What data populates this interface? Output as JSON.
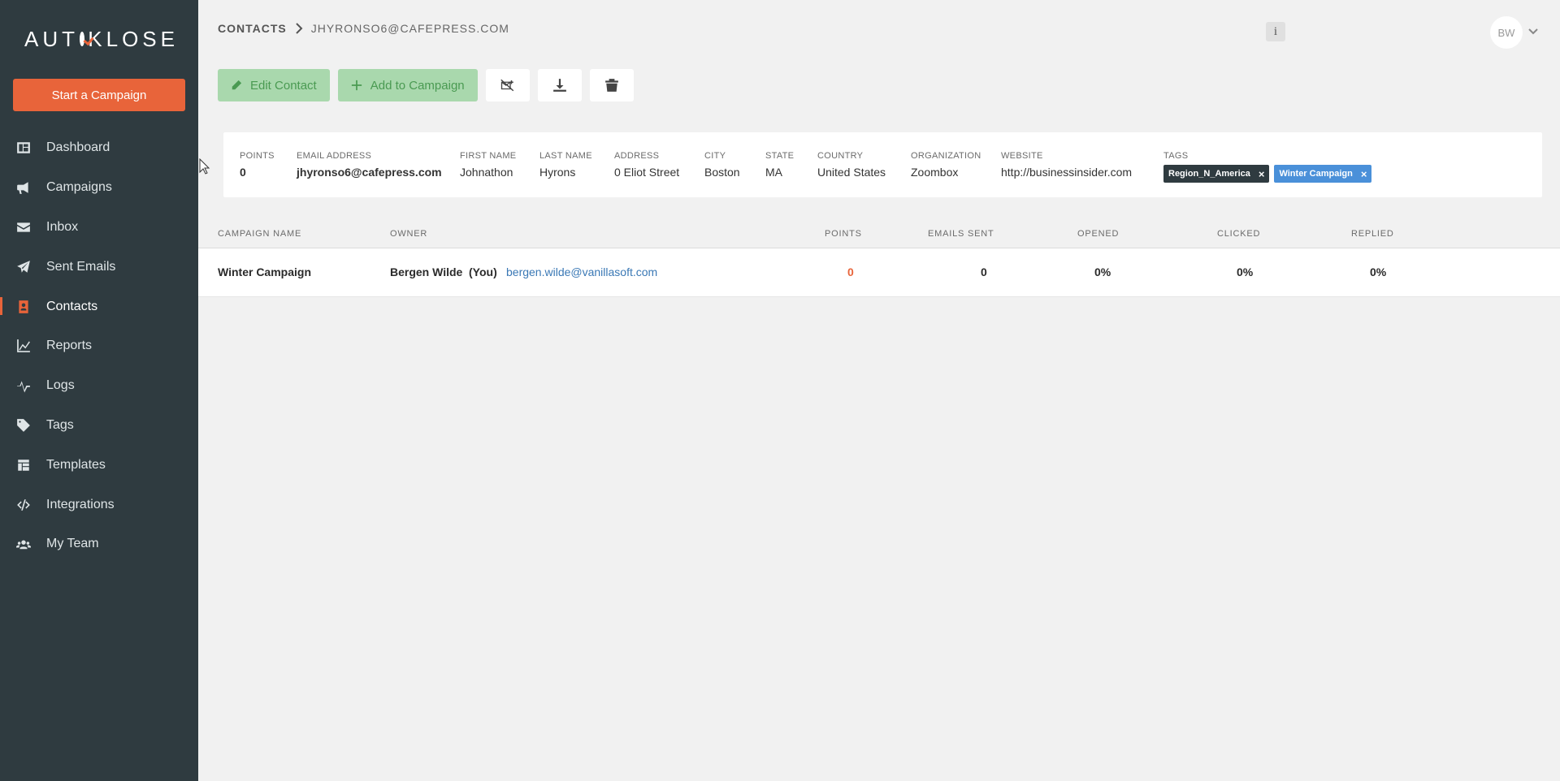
{
  "app": {
    "logo_text_1": "AUT",
    "logo_text_2": "KLOSE",
    "start_campaign_label": "Start a Campaign",
    "brand_color": "#e8643a"
  },
  "sidebar": {
    "items": [
      {
        "label": "Dashboard",
        "icon": "dashboard-icon"
      },
      {
        "label": "Campaigns",
        "icon": "megaphone-icon"
      },
      {
        "label": "Inbox",
        "icon": "envelope-icon"
      },
      {
        "label": "Sent Emails",
        "icon": "paper-plane-icon"
      },
      {
        "label": "Contacts",
        "icon": "contact-card-icon",
        "active": true
      },
      {
        "label": "Reports",
        "icon": "chart-icon"
      },
      {
        "label": "Logs",
        "icon": "pulse-icon"
      },
      {
        "label": "Tags",
        "icon": "tag-icon"
      },
      {
        "label": "Templates",
        "icon": "template-icon"
      },
      {
        "label": "Integrations",
        "icon": "code-icon"
      },
      {
        "label": "My Team",
        "icon": "users-icon"
      }
    ]
  },
  "header": {
    "breadcrumb_root": "CONTACTS",
    "breadcrumb_current": "JHYRONSO6@CAFEPRESS.COM",
    "info_label": "i",
    "avatar_initials": "BW"
  },
  "toolbar": {
    "edit_label": "Edit Contact",
    "add_label": "Add to Campaign",
    "unsubscribe_icon": "unsubscribe-icon",
    "download_icon": "download-icon",
    "delete_icon": "trash-icon"
  },
  "contact": {
    "points_label": "POINTS",
    "points": "0",
    "email_label": "EMAIL ADDRESS",
    "email": "jhyronso6@cafepress.com",
    "first_name_label": "FIRST NAME",
    "first_name": "Johnathon",
    "last_name_label": "LAST NAME",
    "last_name": "Hyrons",
    "address_label": "ADDRESS",
    "address": "0 Eliot Street",
    "city_label": "CITY",
    "city": "Boston",
    "state_label": "STATE",
    "state": "MA",
    "country_label": "COUNTRY",
    "country": "United States",
    "organization_label": "ORGANIZATION",
    "organization": "Zoombox",
    "website_label": "WEBSITE",
    "website": "http://businessinsider.com",
    "tags_label": "TAGS",
    "tags": [
      {
        "label": "Region_N_America",
        "remove": "×",
        "color": "#2f3b40"
      },
      {
        "label": "Winter Campaign",
        "remove": "×",
        "color": "#4a90d9"
      }
    ]
  },
  "table": {
    "headers": {
      "campaign_name": "CAMPAIGN NAME",
      "owner": "OWNER",
      "points": "POINTS",
      "emails_sent": "EMAILS SENT",
      "opened": "OPENED",
      "clicked": "CLICKED",
      "replied": "REPLIED"
    },
    "rows": [
      {
        "campaign_name": "Winter Campaign",
        "owner_name": "Bergen Wilde",
        "owner_you": "(You)",
        "owner_email": "bergen.wilde@vanillasoft.com",
        "points": "0",
        "emails_sent": "0",
        "opened": "0%",
        "clicked": "0%",
        "replied": "0%"
      }
    ]
  }
}
